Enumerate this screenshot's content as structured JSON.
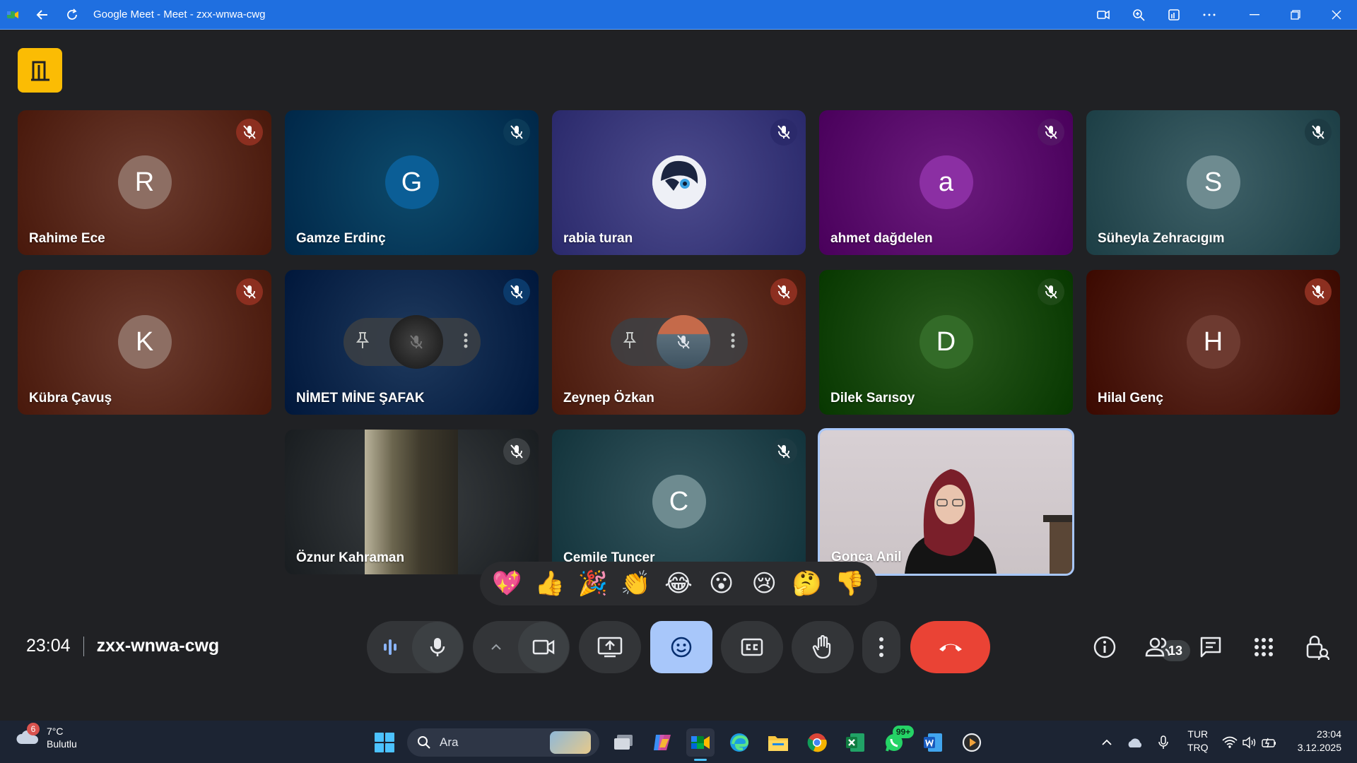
{
  "window": {
    "title": "Google Meet - Meet - zxx-wnwa-cwg"
  },
  "participants": [
    {
      "name": "Rahime Ece",
      "initial": "R",
      "bg": "#6b3b2e",
      "avatar_bg": "#8d6e63",
      "mute_bg": "#8c2f20"
    },
    {
      "name": "Gamze Erdinç",
      "initial": "G",
      "bg": "#0d4a6b",
      "avatar_bg": "#0b5e96",
      "mute_bg": "#0b3a58"
    },
    {
      "name": "rabia turan",
      "initial": "",
      "bg": "#4d4c8e",
      "avatar_bg": "#dfe3f0",
      "mute_bg": "#2b2a6b"
    },
    {
      "name": "ahmet dağdelen",
      "initial": "a",
      "bg": "#6c1c7e",
      "avatar_bg": "#8b2fa3",
      "mute_bg": "#541466"
    },
    {
      "name": "Süheyla Zehracıgım",
      "initial": "S",
      "bg": "#3f6168",
      "avatar_bg": "#6e8b90",
      "mute_bg": "#1d3b43"
    },
    {
      "name": "Kübra Çavuş",
      "initial": "K",
      "bg": "#6b3b2e",
      "avatar_bg": "#8d6e63",
      "mute_bg": "#8c2f20"
    },
    {
      "name": "NİMET MİNE ŞAFAK",
      "initial": "",
      "bg": "#1f3a5e",
      "avatar_bg": "#333",
      "mute_bg": "#0b3a6b"
    },
    {
      "name": "Zeynep Özkan",
      "initial": "",
      "bg": "#6b3b2e",
      "avatar_bg": "#556",
      "mute_bg": "#8c2f20"
    },
    {
      "name": "Dilek Sarısoy",
      "initial": "D",
      "bg": "#2a5a1e",
      "avatar_bg": "#336b28",
      "mute_bg": "#1e4a16"
    },
    {
      "name": "Hilal Genç",
      "initial": "H",
      "bg": "#5e2c22",
      "avatar_bg": "#6d3a30",
      "mute_bg": "#8c2f20"
    },
    {
      "name": "Öznur Kahraman",
      "initial": "",
      "bg": "#3c4043",
      "avatar_bg": "",
      "mute_bg": "#3c4043"
    },
    {
      "name": "Cemile Tuncer",
      "initial": "C",
      "bg": "#35565e",
      "avatar_bg": "#6e8b90",
      "mute_bg": "#1d3b43"
    },
    {
      "name": "Gonca Anil",
      "initial": "",
      "bg": "#cfc6c9",
      "avatar_bg": "",
      "mute_bg": ""
    }
  ],
  "reactions": [
    "💖",
    "👍",
    "🎉",
    "👏",
    "😂",
    "😮",
    "😢",
    "🤔",
    "👎"
  ],
  "meeting": {
    "time": "23:04",
    "code": "zxx-wnwa-cwg",
    "participant_count": "13"
  },
  "taskbar": {
    "weather_badge": "6",
    "temperature": "7°C",
    "condition": "Bulutlu",
    "search_placeholder": "Ara",
    "whatsapp_badge": "99+",
    "lang_top": "TUR",
    "lang_bottom": "TRQ",
    "clock_time": "23:04",
    "clock_date": "3.12.2025"
  },
  "colors": {
    "titlebar": "#1f6fe0",
    "leave": "#fbbc04",
    "end_call": "#ea4335",
    "active_button": "#a8c7fa"
  }
}
